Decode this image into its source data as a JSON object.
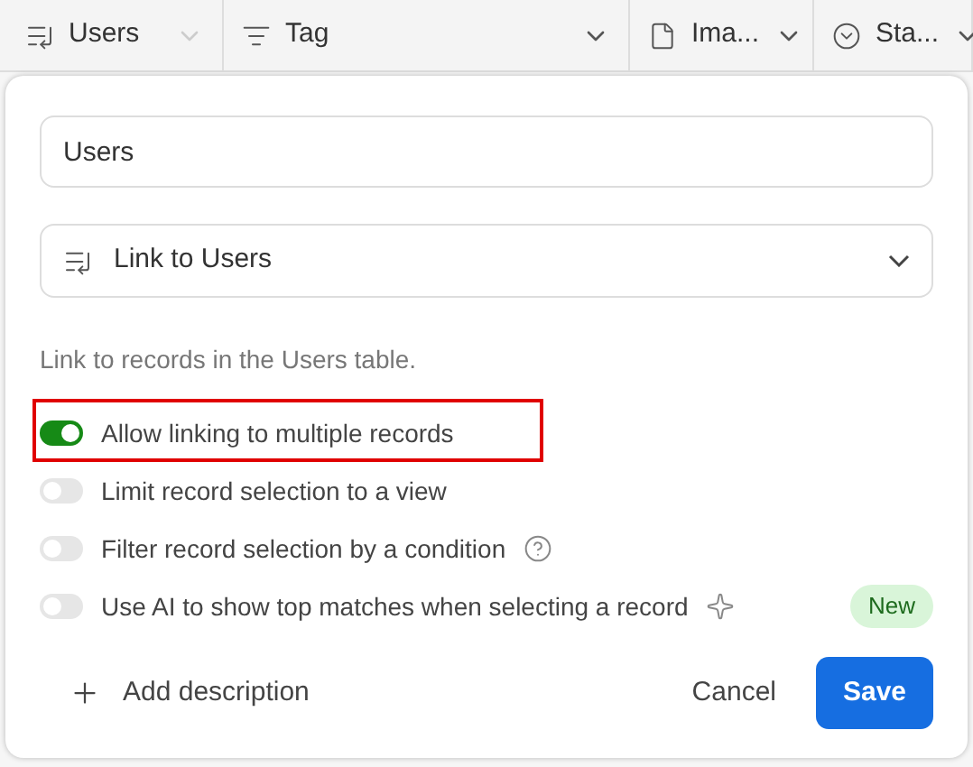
{
  "columns": [
    {
      "kind": "link",
      "label": "Users",
      "caret_muted": true
    },
    {
      "kind": "tag",
      "label": "Tag",
      "caret_muted": false
    },
    {
      "kind": "file",
      "label": "Ima...",
      "caret_muted": false
    },
    {
      "kind": "status",
      "label": "Sta...",
      "caret_muted": false
    }
  ],
  "dialog": {
    "name_value": "Users",
    "type_label": "Link to Users",
    "description": "Link to records in the Users table.",
    "options": [
      {
        "kind": "plain",
        "label": "Allow linking to multiple records",
        "on": true,
        "highlighted": true
      },
      {
        "kind": "plain",
        "label": "Limit record selection to a view",
        "on": false,
        "highlighted": false
      },
      {
        "kind": "help",
        "label": "Filter record selection by a condition",
        "on": false,
        "highlighted": false
      },
      {
        "kind": "ai",
        "label": "Use AI to show top matches when selecting a record",
        "on": false,
        "highlighted": false,
        "badge": "New"
      }
    ],
    "add_description": "Add description",
    "cancel": "Cancel",
    "save": "Save"
  }
}
